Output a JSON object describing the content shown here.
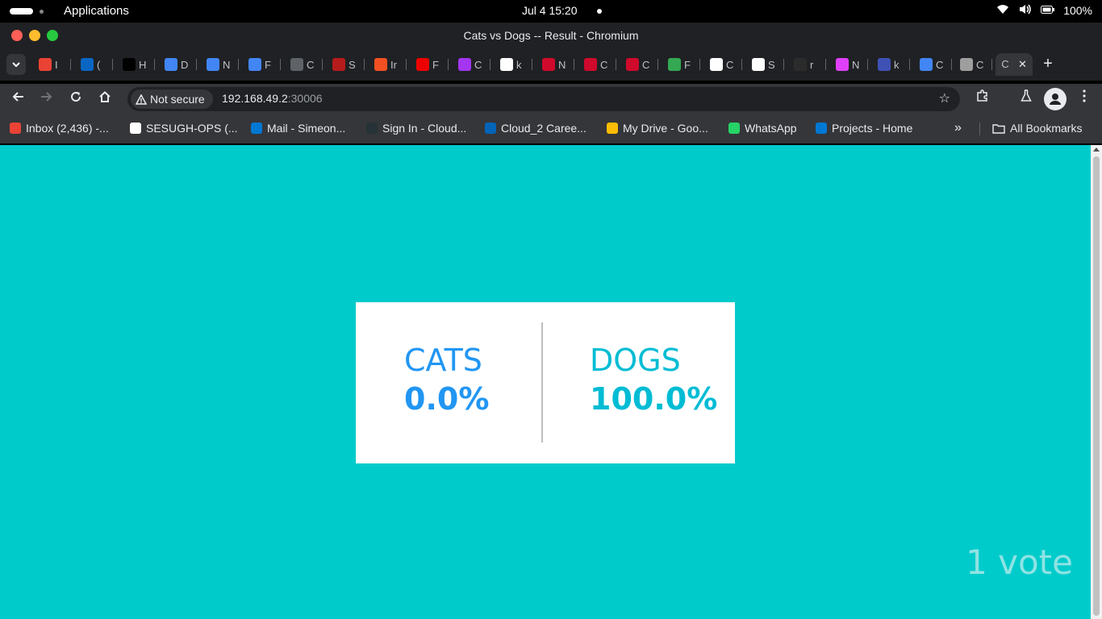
{
  "system": {
    "apps_label": "Applications",
    "clock": "Jul 4  15:20",
    "battery": "100%"
  },
  "window": {
    "title": "Cats vs Dogs -- Result - Chromium"
  },
  "tabs": {
    "items": [
      {
        "icon": "gmail-icon",
        "text": "I",
        "color": "#ea4335"
      },
      {
        "icon": "linkedin-icon",
        "text": "(",
        "color": "#0a66c2"
      },
      {
        "icon": "x-icon",
        "text": "H",
        "color": "#000000"
      },
      {
        "icon": "docs-icon",
        "text": "D",
        "color": "#4285f4"
      },
      {
        "icon": "docs-icon",
        "text": "N",
        "color": "#4285f4"
      },
      {
        "icon": "docs-icon",
        "text": "F",
        "color": "#4285f4"
      },
      {
        "icon": "link-icon",
        "text": "C",
        "color": "#5f6368"
      },
      {
        "icon": "site-icon",
        "text": "S",
        "color": "#b71c1c"
      },
      {
        "icon": "microsoft-icon",
        "text": "Ir",
        "color": "#f25022"
      },
      {
        "icon": "redhat-icon",
        "text": "F",
        "color": "#ee0000"
      },
      {
        "icon": "udemy-icon",
        "text": "C",
        "color": "#a435f0"
      },
      {
        "icon": "github-icon",
        "text": "k",
        "color": "#ffffff"
      },
      {
        "icon": "huawei-icon",
        "text": "N",
        "color": "#cf0a2c"
      },
      {
        "icon": "huawei-icon",
        "text": "C",
        "color": "#cf0a2c"
      },
      {
        "icon": "huawei-icon",
        "text": "C",
        "color": "#cf0a2c"
      },
      {
        "icon": "fi-icon",
        "text": "F",
        "color": "#34a853"
      },
      {
        "icon": "openai-icon",
        "text": "C",
        "color": "#ffffff"
      },
      {
        "icon": "github-icon",
        "text": "S",
        "color": "#ffffff"
      },
      {
        "icon": "dark-icon",
        "text": "r",
        "color": "#2b2b2b"
      },
      {
        "icon": "cube-icon",
        "text": "N",
        "color": "#e040fb"
      },
      {
        "icon": "circle-icon",
        "text": "k",
        "color": "#3f51b5"
      },
      {
        "icon": "gemini-icon",
        "text": "C",
        "color": "#4285f4"
      },
      {
        "icon": "globe-icon",
        "text": "C",
        "color": "#9e9e9e"
      }
    ],
    "active_text": "C",
    "close_glyph": "✕",
    "new_tab_glyph": "+"
  },
  "toolbar": {
    "not_secure_label": "Not secure",
    "url_host": "192.168.49.2",
    "url_port": ":30006"
  },
  "bookmarks": {
    "items": [
      {
        "label": "Inbox (2,436) -...",
        "icon": "gmail-icon",
        "color": "#ea4335"
      },
      {
        "label": "SESUGH-OPS (...",
        "icon": "github-icon",
        "color": "#ffffff"
      },
      {
        "label": "Mail - Simeon...",
        "icon": "outlook-icon",
        "color": "#0078d4"
      },
      {
        "label": "Sign In - Cloud...",
        "icon": "cloud-icon",
        "color": "#263238"
      },
      {
        "label": "Cloud_2 Caree...",
        "icon": "onedrive-icon",
        "color": "#0364b8"
      },
      {
        "label": "My Drive - Goo...",
        "icon": "drive-icon",
        "color": "#fbbc04"
      },
      {
        "label": "WhatsApp",
        "icon": "whatsapp-icon",
        "color": "#25d366"
      },
      {
        "label": "Projects - Home",
        "icon": "azure-devops-icon",
        "color": "#0078d4"
      }
    ],
    "more_glyph": "»",
    "all_bookmarks_label": "All Bookmarks"
  },
  "results": {
    "cats_label": "CATS",
    "cats_percent": "0.0%",
    "dogs_label": "DOGS",
    "dogs_percent": "100.0%",
    "vote_count": "1 vote"
  },
  "colors": {
    "page_bg": "#00cbcb",
    "cats": "#2196f3",
    "dogs": "#00bcd4",
    "votes": "#8fe3e3"
  }
}
